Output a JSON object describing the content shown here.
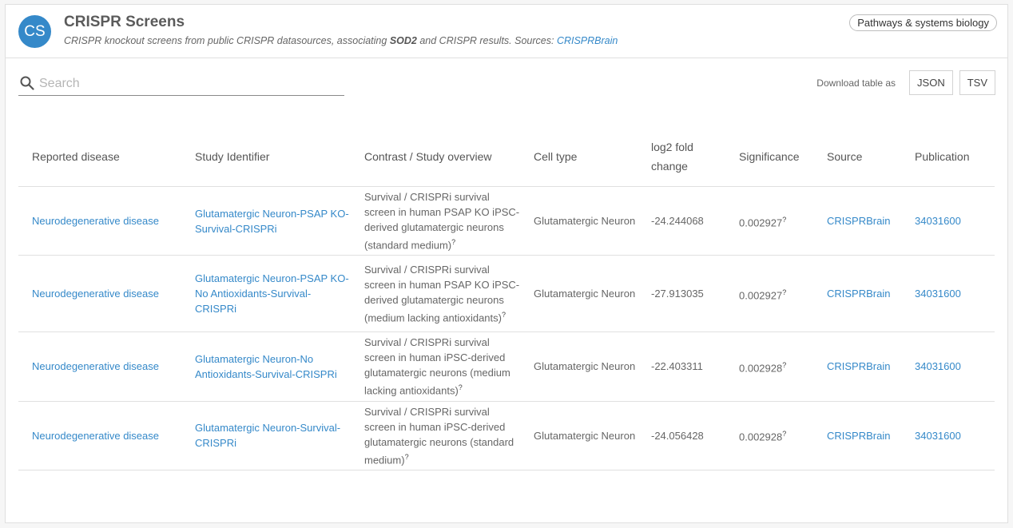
{
  "header": {
    "avatar_initials": "CS",
    "title": "CRISPR Screens",
    "subtitle_prefix": "CRISPR knockout screens from public CRISPR datasources, associating ",
    "gene": "SOD2",
    "subtitle_middle": " and CRISPR results. Sources: ",
    "source_link": "CRISPRBrain",
    "category_chip": "Pathways & systems biology"
  },
  "search": {
    "placeholder": "Search",
    "value": ""
  },
  "download": {
    "label": "Download table as",
    "json_label": "JSON",
    "tsv_label": "TSV"
  },
  "table": {
    "columns": [
      "Reported disease",
      "Study Identifier",
      "Contrast / Study overview",
      "Cell type",
      "log2 fold change",
      "Significance",
      "Source",
      "Publication"
    ],
    "rows": [
      {
        "disease": "Neurodegenerative disease",
        "study_id": "Glutamatergic Neuron-PSAP KO-Survival-CRISPRi",
        "overview": "Survival / CRISPRi survival screen in human PSAP KO iPSC-derived glutamatergic neurons (standard medium)",
        "cell_type": "Glutamatergic Neuron",
        "log2fc": "-24.244068",
        "significance": "0.002927",
        "source": "CRISPRBrain",
        "publication": "34031600"
      },
      {
        "disease": "Neurodegenerative disease",
        "study_id": "Glutamatergic Neuron-PSAP KO-No Antioxidants-Survival-CRISPRi",
        "overview": "Survival / CRISPRi survival screen in human PSAP KO iPSC-derived glutamatergic neurons (medium lacking antioxidants)",
        "cell_type": "Glutamatergic Neuron",
        "log2fc": "-27.913035",
        "significance": "0.002927",
        "source": "CRISPRBrain",
        "publication": "34031600"
      },
      {
        "disease": "Neurodegenerative disease",
        "study_id": "Glutamatergic Neuron-No Antioxidants-Survival-CRISPRi",
        "overview": "Survival / CRISPRi survival screen in human iPSC-derived glutamatergic neurons (medium lacking antioxidants)",
        "cell_type": "Glutamatergic Neuron",
        "log2fc": "-22.403311",
        "significance": "0.002928",
        "source": "CRISPRBrain",
        "publication": "34031600"
      },
      {
        "disease": "Neurodegenerative disease",
        "study_id": "Glutamatergic Neuron-Survival-CRISPRi",
        "overview": "Survival / CRISPRi survival screen in human iPSC-derived glutamatergic neurons (standard medium)",
        "cell_type": "Glutamatergic Neuron",
        "log2fc": "-24.056428",
        "significance": "0.002928",
        "source": "CRISPRBrain",
        "publication": "34031600"
      }
    ],
    "tooltip_marker": "?"
  },
  "colors": {
    "accent": "#3589c9"
  }
}
